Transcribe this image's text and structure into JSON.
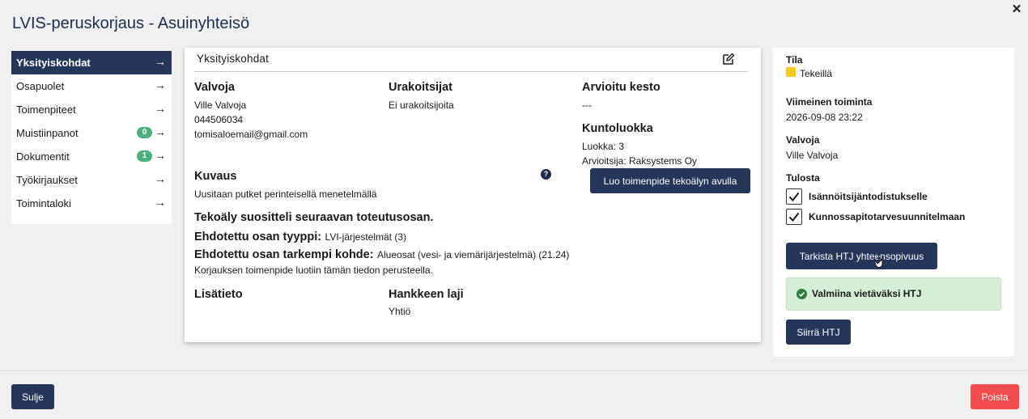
{
  "window": {
    "title": "LVIS-peruskorjaus - Asuinyhteisö",
    "close_icon": "close-icon"
  },
  "sidebar": {
    "items": [
      {
        "label": "Yksityiskohdat",
        "active": true
      },
      {
        "label": "Osapuolet"
      },
      {
        "label": "Toimenpiteet"
      },
      {
        "label": "Muistiinpanot",
        "badge": "0"
      },
      {
        "label": "Dokumentit",
        "badge": "1"
      },
      {
        "label": "Työkirjaukset"
      },
      {
        "label": "Toimintaloki"
      }
    ],
    "arrow": "→"
  },
  "details": {
    "header": "Yksityiskohdat",
    "valvoja": {
      "label": "Valvoja",
      "name": "Ville Valvoja",
      "phone": "044506034",
      "email": "tomisaloemail@gmail.com"
    },
    "urakoitsijat": {
      "label": "Urakoitsijat",
      "value": "Ei urakoitsijoita"
    },
    "kesto": {
      "label": "Arvioitu kesto",
      "value": "---"
    },
    "kuntoluokka": {
      "label": "Kuntoluokka",
      "luokka": "Luokka: 3",
      "arvioitsija": "Arvioitsija: Raksystems Oy"
    },
    "kuvaus": {
      "label": "Kuvaus",
      "value": "Uusitaan putket perinteisellä menetelmällä"
    },
    "help": "?",
    "ai_button": "Luo toimenpide tekoälyn avulla",
    "ai": {
      "heading": "Tekoäly suositteli seuraavan toteutusosan.",
      "type_label": "Ehdotettu osan tyyppi:",
      "type_value": "LVI-järjestelmät (3)",
      "target_label": "Ehdotettu osan tarkempi kohde:",
      "target_value": "Alueosat (vesi- ja viemärijärjestelmä) (21.24)",
      "note": "Korjauksen toimenpide luotiin tämän tiedon perusteella."
    },
    "lisatieto": {
      "label": "Lisätieto"
    },
    "hankkeen_laji": {
      "label": "Hankkeen laji",
      "value": "Yhtiö"
    }
  },
  "status_panel": {
    "tila_label": "Tila",
    "tila_value": "Tekeillä",
    "tila_color": "#f5cc1a",
    "last_action_label": "Viimeinen toiminta",
    "last_action_value": "2026-09-08 23:22",
    "valvoja_label": "Valvoja",
    "valvoja_value": "Ville Valvoja",
    "tulosta_label": "Tulosta",
    "checks": [
      {
        "label": "Isännöitsijäntodistukselle",
        "checked": true
      },
      {
        "label": "Kunnossapitotarvesuunnitelmaan",
        "checked": true
      }
    ],
    "check_button": "Tarkista HTJ yhteensopivuus",
    "success_text": "Valmiina vietäväksi HTJ",
    "success_color": "#2f7d3d",
    "move_button": "Siirrä HTJ"
  },
  "footer": {
    "close_button": "Sulje",
    "delete_button": "Poista",
    "delete_color": "#f44c4c"
  }
}
